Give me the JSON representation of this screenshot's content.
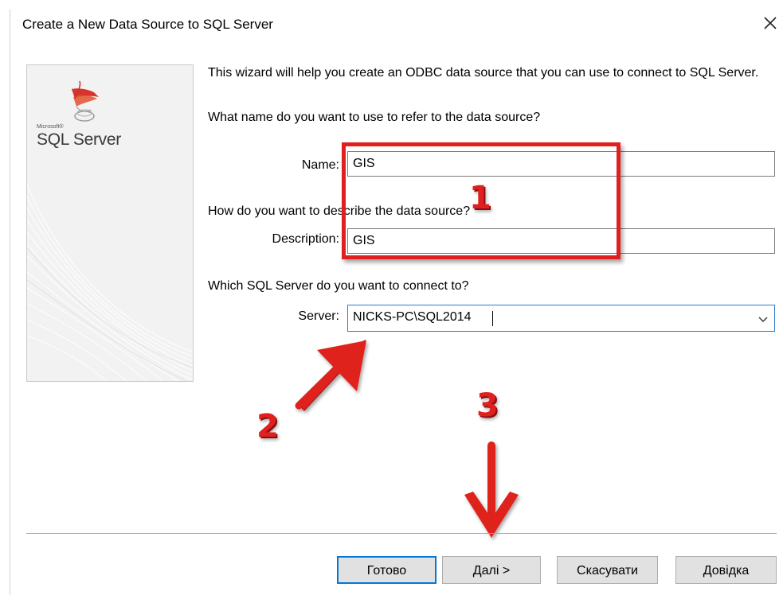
{
  "dialog": {
    "title": "Create a New Data Source to SQL Server",
    "close_icon": "close-icon"
  },
  "branding": {
    "logo_small": "Microsoft®",
    "logo_text": "SQL Server",
    "logo_icon": "sql-server-logo-icon"
  },
  "wizard": {
    "intro": "This wizard will help you create an ODBC data source that you can use to connect to SQL Server.",
    "name_question": "What name do you want to use to refer to the data source?",
    "name_label": "Name:",
    "name_value": "GIS",
    "description_question": "How do you want to describe the data source?",
    "description_label": "Description:",
    "description_value": "GIS",
    "server_question": "Which SQL Server do you want to connect to?",
    "server_label": "Server:",
    "server_value": "NICKS-PC\\SQL2014",
    "server_dropdown_icon": "chevron-down-icon"
  },
  "annotations": {
    "step1": "1",
    "step2": "2",
    "step3": "3",
    "color": "#e0201e"
  },
  "buttons": {
    "finish": "Готово",
    "next": "Далі >",
    "cancel": "Скасувати",
    "help": "Довідка"
  },
  "colors": {
    "focus_blue": "#0078d7",
    "button_bg": "#e1e1e1",
    "panel_bg": "#f2f2f2"
  }
}
